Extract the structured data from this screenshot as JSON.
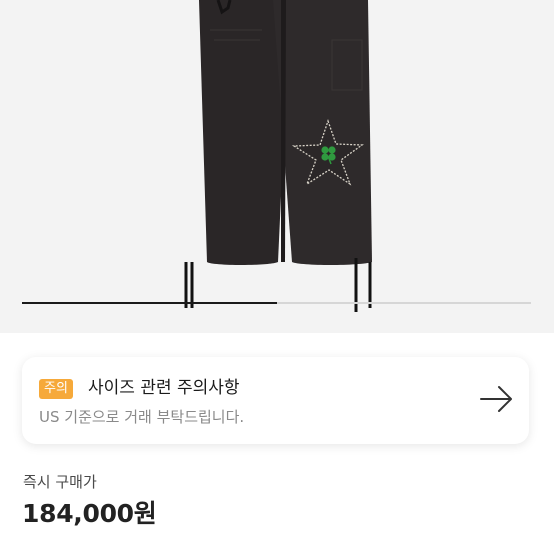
{
  "hero": {
    "image_icon": "pants-product-image",
    "slide_progress": 0.5
  },
  "notice": {
    "badge": "주의",
    "title": "사이즈 관련 주의사항",
    "subtitle": "US 기준으로 거래 부탁드립니다.",
    "arrow_icon": "arrow-right-icon"
  },
  "price": {
    "label": "즉시 구매가",
    "value": "184,000원"
  },
  "colors": {
    "badge": "#f6a93a",
    "title": "#1b1b1b",
    "muted": "#8a8a8a"
  }
}
